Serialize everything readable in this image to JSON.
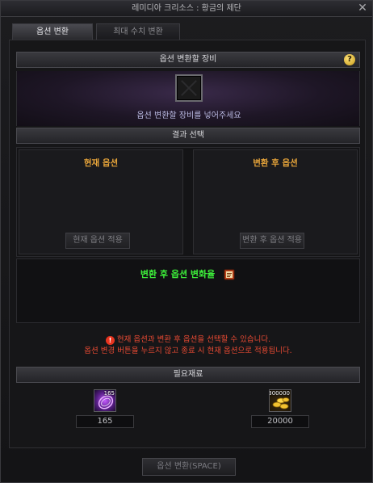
{
  "window": {
    "title": "레미디아 크리소스 : 황금의 제단",
    "close_glyph": "✕"
  },
  "tabs": [
    {
      "label": "옵션 변환",
      "active": true
    },
    {
      "label": "최대 수치 변환",
      "active": false
    }
  ],
  "equipment": {
    "header": "옵션 변환할 장비",
    "help_glyph": "?",
    "hint": "옵션 변환할 장비를 넣어주세요"
  },
  "result_selection": {
    "header": "결과 선택",
    "current": {
      "title": "현재 옵션",
      "button": "현재 옵션 적용"
    },
    "after": {
      "title": "변환 후 옵션",
      "button": "변환 후 옵션 적용"
    },
    "result_text": "변환 후 옵션 변화율",
    "result_icon": "book-icon"
  },
  "warning": {
    "icon_glyph": "!",
    "line1": "현재 옵션과 변환 후 옵션을 선택할 수 있습니다.",
    "line2": "옵션 변경 버튼을 누르지 않고 종료 시 현재 옵션으로 적용됩니다."
  },
  "materials": {
    "header": "필요재료",
    "items": [
      {
        "icon": "purple-crystal-icon",
        "badge": "165",
        "value": "165"
      },
      {
        "icon": "gold-coins-icon",
        "badge": "300000",
        "value": "20000"
      }
    ]
  },
  "submit": {
    "label": "옵션 변환(SPACE)"
  },
  "colors": {
    "accent_orange": "#e8a53a",
    "result_green": "#3df03a",
    "warning_red": "#e84a33"
  }
}
